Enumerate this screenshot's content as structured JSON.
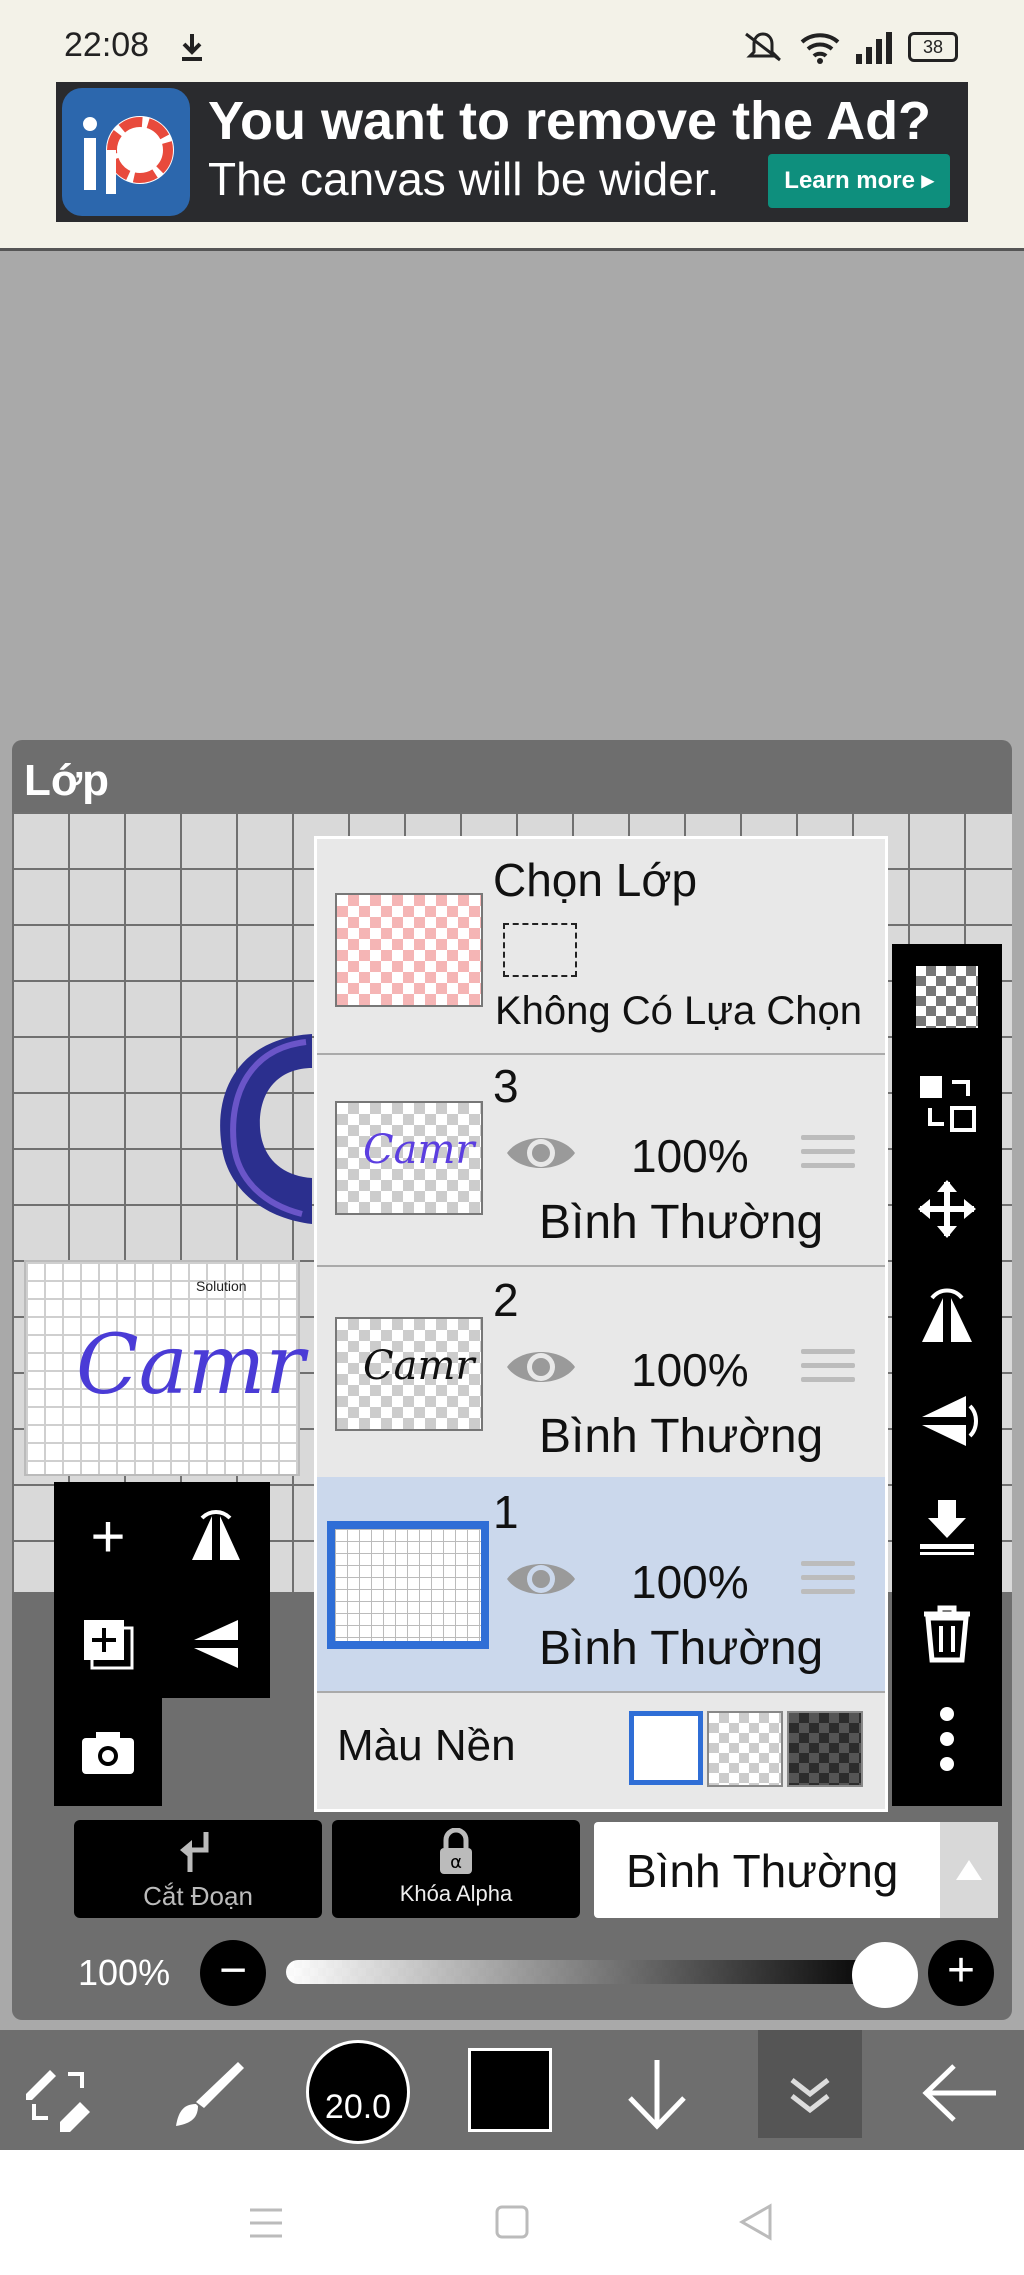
{
  "status": {
    "time": "22:08",
    "battery": "38"
  },
  "ad": {
    "title": "You want to remove the Ad?",
    "subtitle": "The canvas will be wider.",
    "learn_more": "Learn more"
  },
  "panel": {
    "title": "Lớp"
  },
  "selection_row": {
    "title": "Chọn Lớp",
    "status": "Không Có Lựa Chọn"
  },
  "layers": [
    {
      "num": "3",
      "opacity": "100%",
      "mode": "Bình Thường",
      "thumb_text": "Camr"
    },
    {
      "num": "2",
      "opacity": "100%",
      "mode": "Bình Thường",
      "thumb_text": "Camr"
    },
    {
      "num": "1",
      "opacity": "100%",
      "mode": "Bình Thường"
    }
  ],
  "background": {
    "label": "Màu Nền"
  },
  "controls": {
    "clip": "Cắt Đoạn",
    "alpha_lock": "Khóa Alpha",
    "blend_mode": "Bình Thường",
    "opacity": "100%"
  },
  "preview_text": "Camr",
  "toolbar": {
    "brush_size": "20.0"
  },
  "colors": {
    "panel": "#6e6e6e",
    "selected_row": "#cbd8ec",
    "accent": "#2f6ed6",
    "ad_button": "#0e8f7d"
  }
}
